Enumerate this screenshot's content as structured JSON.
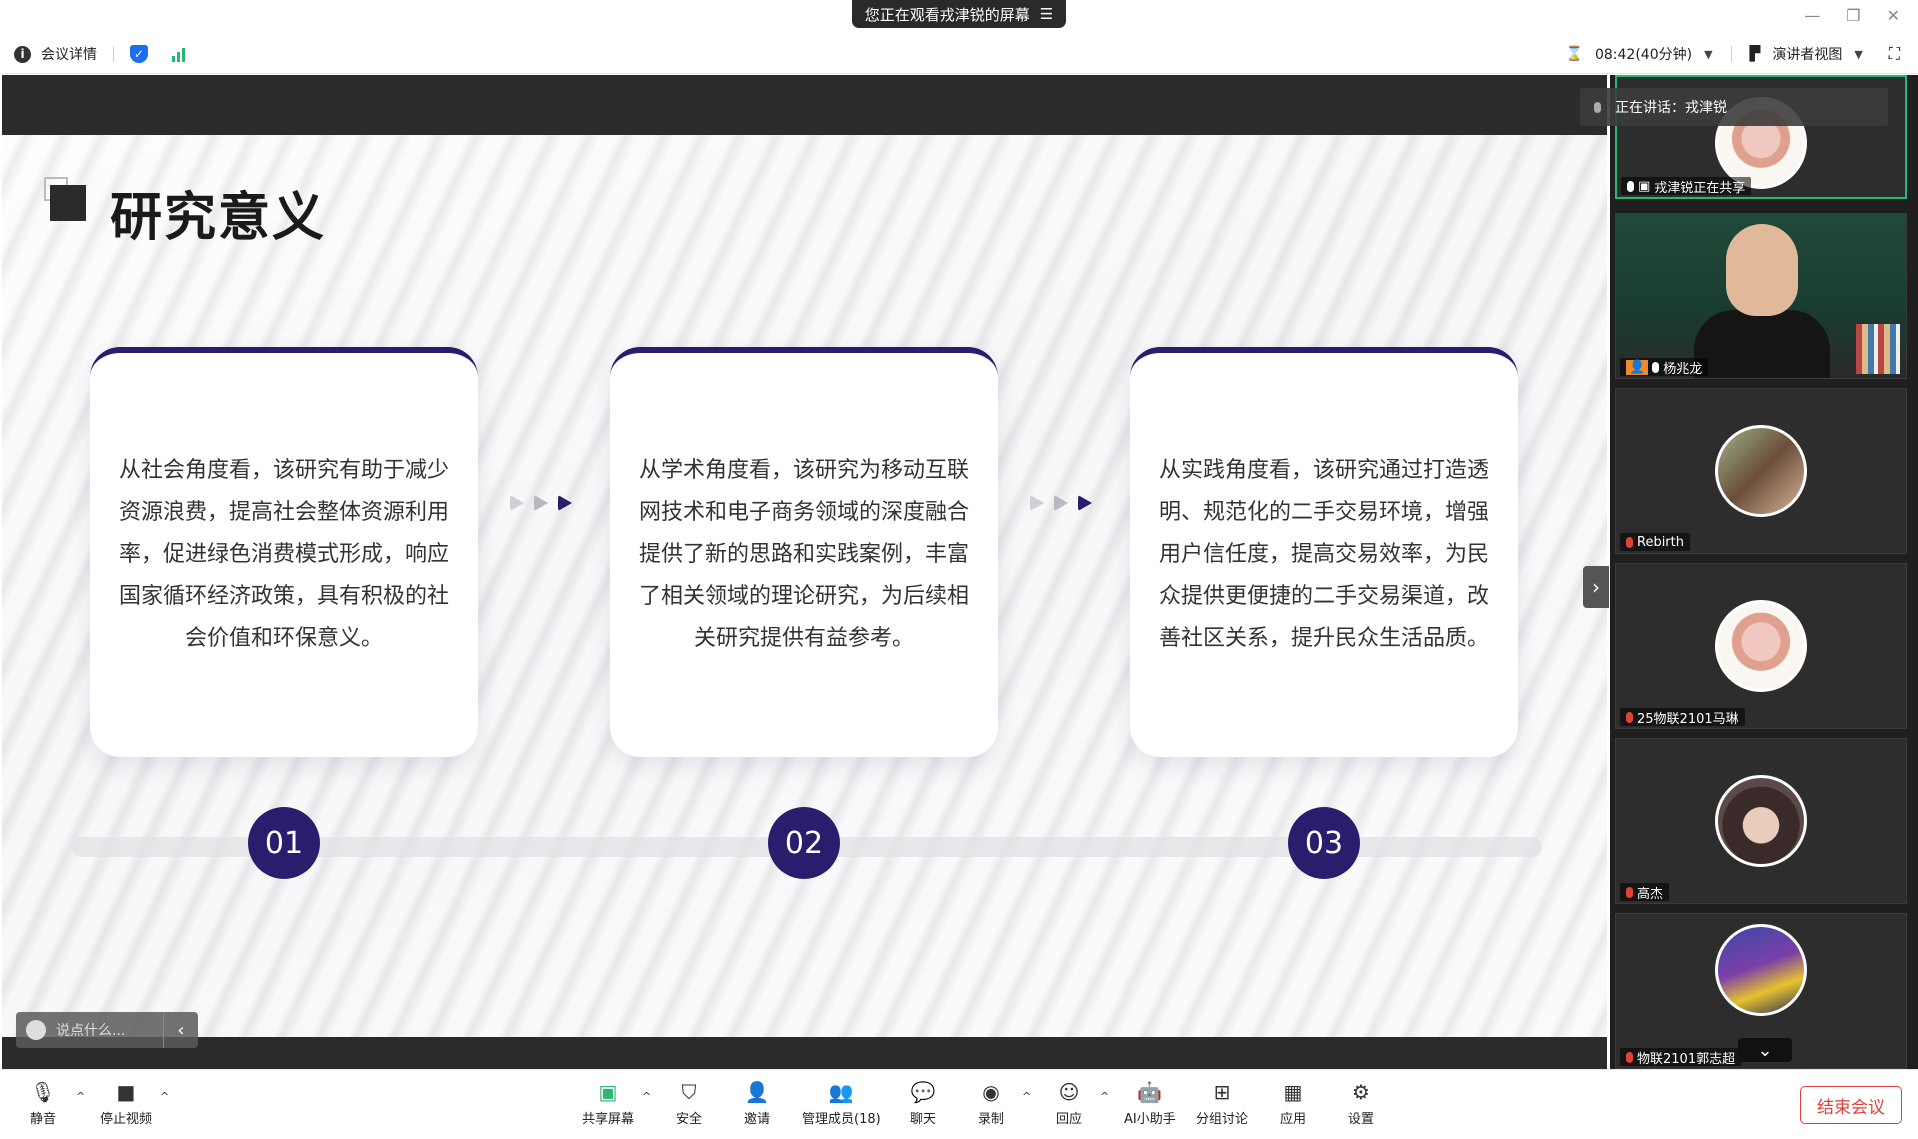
{
  "window": {
    "share_banner": "您正在观看戎津锐的屏幕",
    "share_banner_icon": "menu-icon"
  },
  "header": {
    "meeting_details": "会议详情",
    "timer": "08:42(40分钟)",
    "view_mode": "演讲者视图"
  },
  "slide": {
    "title": "研究意义",
    "cards": [
      {
        "text": "从社会角度看，该研究有助于减少资源浪费，提高社会整体资源利用率，促进绿色消费模式形成，响应国家循环经济政策，具有积极的社会价值和环保意义。",
        "number": "01"
      },
      {
        "text": "从学术角度看，该研究为移动互联网技术和电子商务领域的深度融合提供了新的思路和实践案例，丰富了相关领域的理论研究，为后续相关研究提供有益参考。",
        "number": "02"
      },
      {
        "text": "从实践角度看，该研究通过打造透明、规范化的二手交易环境，增强用户信任度，提高交易效率，为民众提供更便捷的二手交易渠道，改善社区关系，提升民众生活品质。",
        "number": "03"
      }
    ],
    "comment_placeholder": "说点什么..."
  },
  "participants": {
    "speaking_prefix": "正在讲话：",
    "speaking_name": "戎津锐",
    "tiles": [
      {
        "name": "戎津锐正在共享"
      },
      {
        "name": "杨兆龙"
      },
      {
        "name": "Rebirth"
      },
      {
        "name": "25物联2101马琳"
      },
      {
        "name": "高杰"
      },
      {
        "name": "物联2101郭志超"
      }
    ]
  },
  "toolbar": {
    "mute": "静音",
    "stop_video": "停止视频",
    "share_screen": "共享屏幕",
    "security": "安全",
    "invite": "邀请",
    "manage_members": "管理成员(18)",
    "chat": "聊天",
    "record": "录制",
    "react": "回应",
    "ai_assistant": "AI小助手",
    "breakout": "分组讨论",
    "apps": "应用",
    "settings": "设置",
    "end_meeting": "结束会议"
  },
  "colors": {
    "accent": "#2a1d6e",
    "active_tile": "#2bb673",
    "end_meeting": "#e0413a"
  }
}
